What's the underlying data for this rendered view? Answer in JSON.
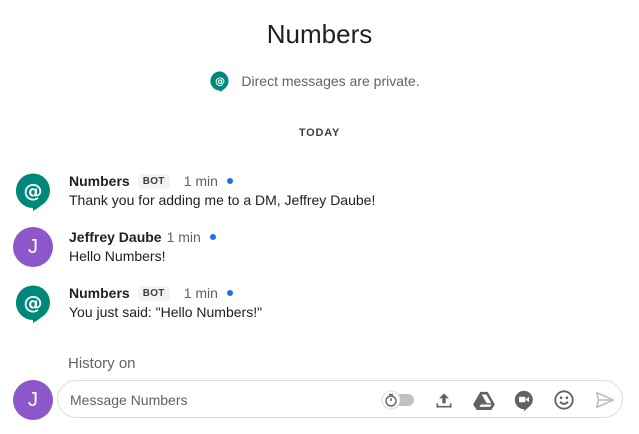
{
  "header": {
    "title": "Numbers",
    "privacy_text": "Direct messages are private."
  },
  "divider": {
    "label": "TODAY"
  },
  "messages": [
    {
      "sender": "Numbers",
      "badge": "BOT",
      "time": "1 min",
      "text": "Thank you for adding me to a DM, Jeffrey Daube!",
      "avatar": "hangouts-chat-icon"
    },
    {
      "sender": "Jeffrey Daube",
      "initial": "J",
      "time": "1 min",
      "text": "Hello Numbers!"
    },
    {
      "sender": "Numbers",
      "badge": "BOT",
      "time": "1 min",
      "text": "You just said: \"Hello Numbers!\"",
      "avatar": "hangouts-chat-icon"
    }
  ],
  "history": {
    "label": "History on"
  },
  "composer": {
    "avatar_initial": "J",
    "placeholder": "Message Numbers",
    "tools": [
      "history-timer-toggle-icon",
      "upload-icon",
      "google-drive-icon",
      "video-meet-icon",
      "emoji-icon",
      "send-icon"
    ]
  },
  "colors": {
    "accent_teal": "#00897b",
    "avatar_purple": "#8e57c9",
    "presence_blue": "#1a73e8"
  }
}
